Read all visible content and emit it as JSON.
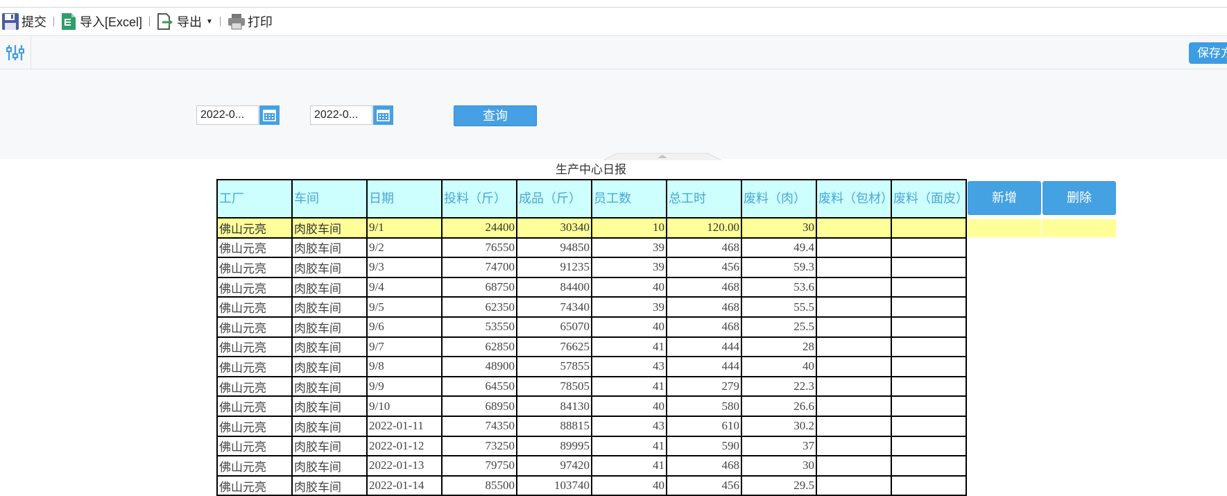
{
  "toolbar": {
    "submit_label": "提交",
    "import_label": "导入[Excel]",
    "export_label": "导出",
    "print_label": "打印"
  },
  "settings_bar": {
    "save_label": "保存方"
  },
  "query": {
    "start_date": "2022-0...",
    "end_date": "2022-0...",
    "query_label": "查询"
  },
  "report": {
    "title": "生产中心日报",
    "columns": [
      "工厂",
      "车间",
      "日期",
      "投料（斤）",
      "成品（斤）",
      "员工数",
      "总工时",
      "废料（肉）",
      "废料（包材）",
      "废料（面皮）"
    ],
    "rows": [
      [
        "佛山元亮",
        "肉胶车间",
        "9/1",
        "24400",
        "30340",
        "10",
        "120.00",
        "30",
        "",
        ""
      ],
      [
        "佛山元亮",
        "肉胶车间",
        "9/2",
        "76550",
        "94850",
        "39",
        "468",
        "49.4",
        "",
        ""
      ],
      [
        "佛山元亮",
        "肉胶车间",
        "9/3",
        "74700",
        "91235",
        "39",
        "456",
        "59.3",
        "",
        ""
      ],
      [
        "佛山元亮",
        "肉胶车间",
        "9/4",
        "68750",
        "84400",
        "40",
        "468",
        "53.6",
        "",
        ""
      ],
      [
        "佛山元亮",
        "肉胶车间",
        "9/5",
        "62350",
        "74340",
        "39",
        "468",
        "55.5",
        "",
        ""
      ],
      [
        "佛山元亮",
        "肉胶车间",
        "9/6",
        "53550",
        "65070",
        "40",
        "468",
        "25.5",
        "",
        ""
      ],
      [
        "佛山元亮",
        "肉胶车间",
        "9/7",
        "62850",
        "76625",
        "41",
        "444",
        "28",
        "",
        ""
      ],
      [
        "佛山元亮",
        "肉胶车间",
        "9/8",
        "48900",
        "57855",
        "43",
        "444",
        "40",
        "",
        ""
      ],
      [
        "佛山元亮",
        "肉胶车间",
        "9/9",
        "64550",
        "78505",
        "41",
        "279",
        "22.3",
        "",
        ""
      ],
      [
        "佛山元亮",
        "肉胶车间",
        "9/10",
        "68950",
        "84130",
        "40",
        "580",
        "26.6",
        "",
        ""
      ],
      [
        "佛山元亮",
        "肉胶车间",
        "2022-01-11",
        "74350",
        "88815",
        "43",
        "610",
        "30.2",
        "",
        ""
      ],
      [
        "佛山元亮",
        "肉胶车间",
        "2022-01-12",
        "73250",
        "89995",
        "41",
        "590",
        "37",
        "",
        ""
      ],
      [
        "佛山元亮",
        "肉胶车间",
        "2022-01-13",
        "79750",
        "97420",
        "41",
        "468",
        "30",
        "",
        ""
      ],
      [
        "佛山元亮",
        "肉胶车间",
        "2022-01-14",
        "85500",
        "103740",
        "40",
        "456",
        "29.5",
        "",
        ""
      ]
    ],
    "add_label": "新增",
    "delete_label": "删除"
  },
  "colors": {
    "accent": "#46a0e3",
    "header_bg": "#ccfffe",
    "header_text": "#4aa6d6",
    "highlight_row": "#ffff99"
  },
  "icons": [
    "save-icon",
    "excel-import-icon",
    "export-icon",
    "printer-icon",
    "settings-sliders-icon",
    "calendar-icon"
  ]
}
